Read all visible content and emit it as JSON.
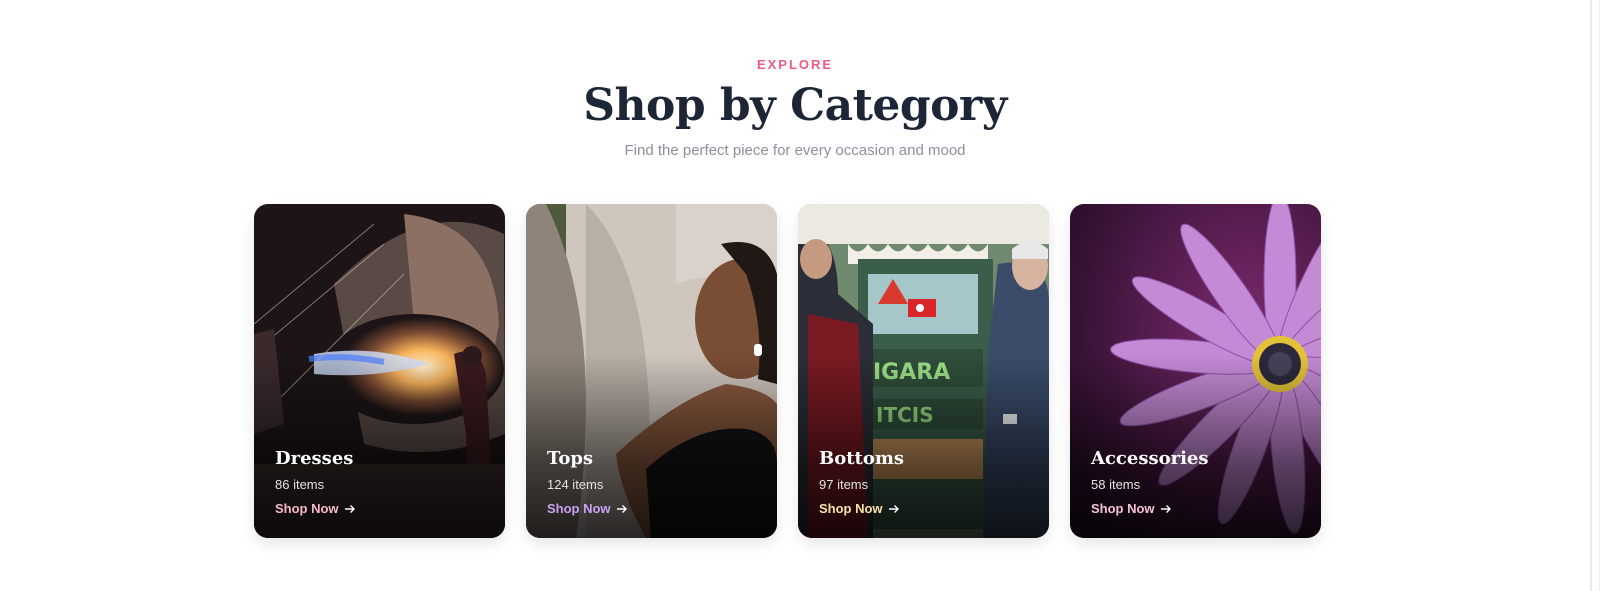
{
  "section": {
    "eyebrow": "EXPLORE",
    "title": "Shop by Category",
    "subtitle": "Find the perfect piece for every occasion and mood"
  },
  "categories": [
    {
      "name": "Dresses",
      "count": "86 items",
      "cta": "Shop Now",
      "cta_color": "#f9b7cb",
      "image": "hot-air-balloon-burner-flame"
    },
    {
      "name": "Tops",
      "count": "124 items",
      "cta": "Shop Now",
      "cta_color": "#c9a2f3",
      "image": "woman-sports-bra-smiling"
    },
    {
      "name": "Bottoms",
      "count": "97 items",
      "cta": "Shop Now",
      "cta_color": "#fbe2a8",
      "image": "street-vendor-cart-men"
    },
    {
      "name": "Accessories",
      "count": "58 items",
      "cta": "Shop Now",
      "cta_color": "#f6c1d6",
      "image": "purple-daisy-flower"
    }
  ],
  "colors": {
    "accent": "#ef5b7f",
    "heading": "#1d2636",
    "muted": "#8a909c"
  }
}
